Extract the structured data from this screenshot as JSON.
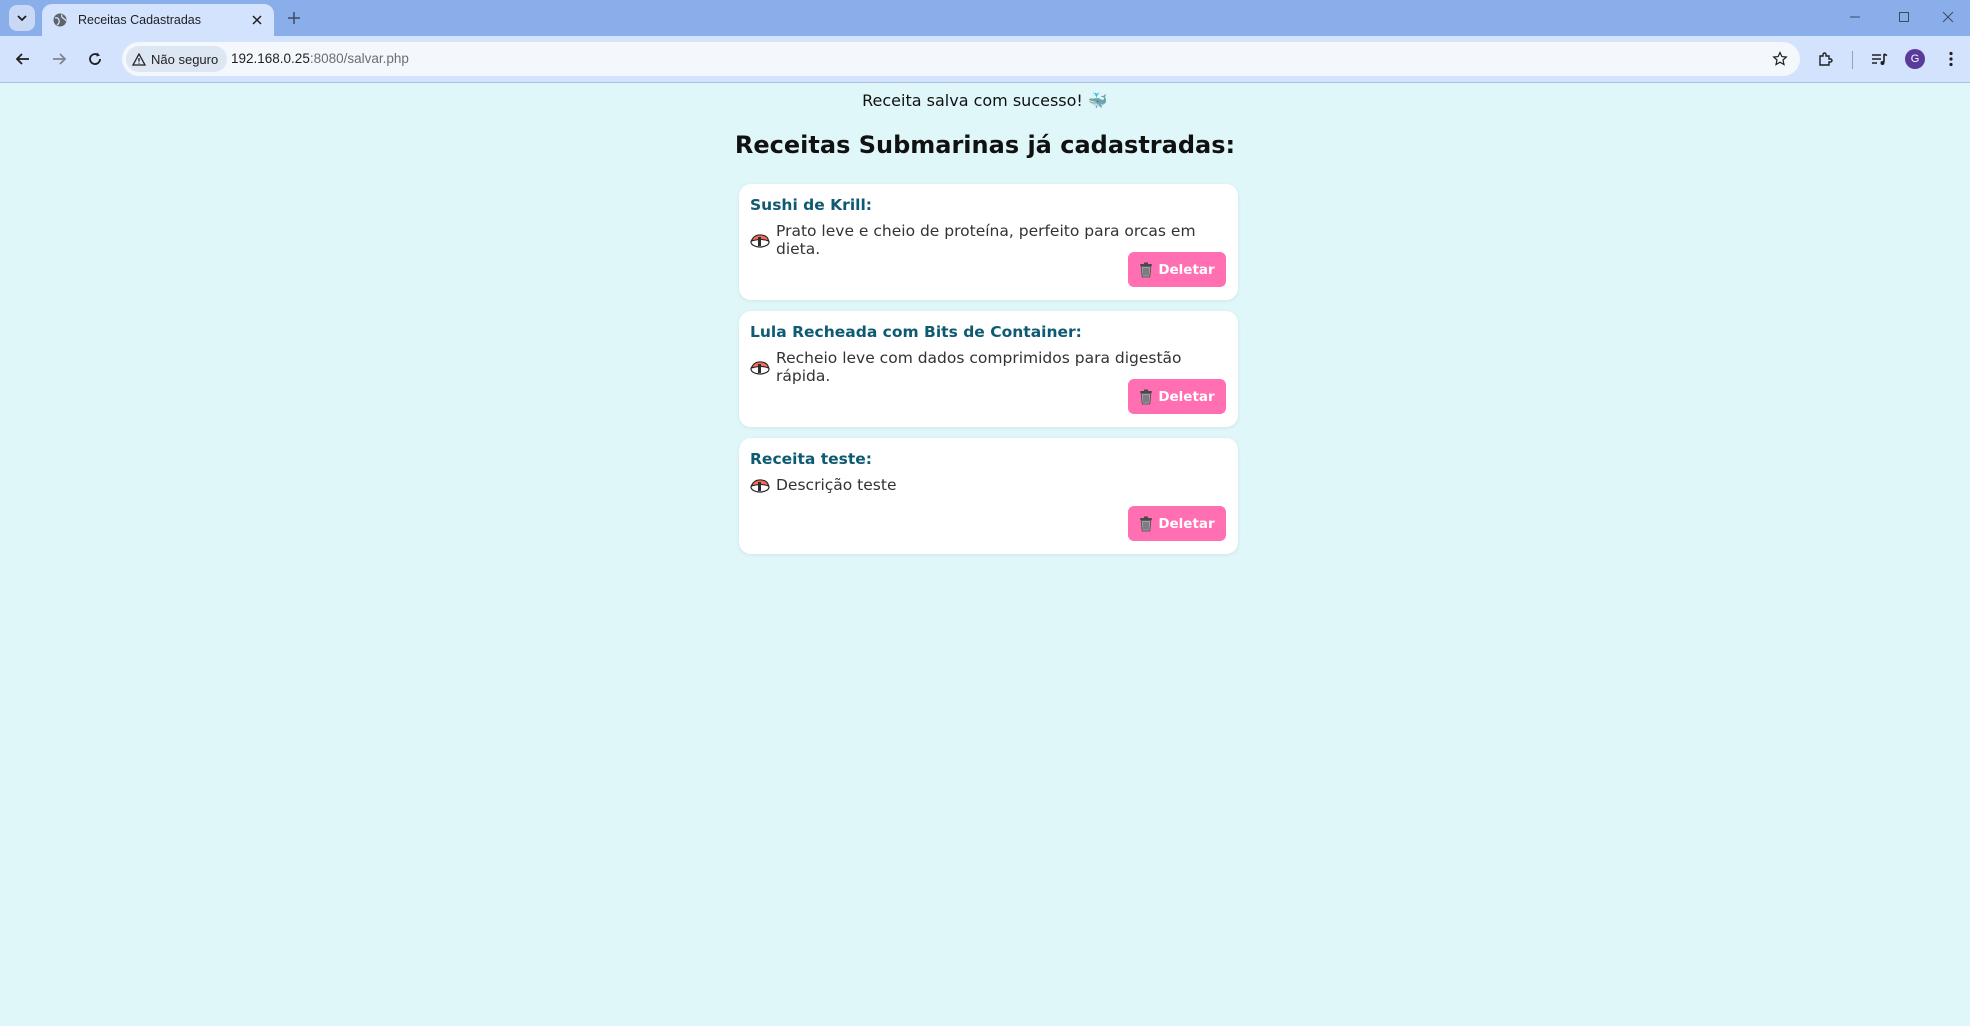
{
  "browser": {
    "tab_title": "Receitas Cadastradas",
    "security_label": "Não seguro",
    "url_host": "192.168.0.25",
    "url_rest": ":8080/salvar.php",
    "profile_initial": "G"
  },
  "page": {
    "success_message": "Receita salva com sucesso! 🐳",
    "title": "Receitas Submarinas já cadastradas:",
    "delete_label": "Deletar",
    "recipes": [
      {
        "name": "Sushi de Krill:",
        "description": "Prato leve e cheio de proteína, perfeito para orcas em dieta."
      },
      {
        "name": "Lula Recheada com Bits de Container:",
        "description": "Recheio leve com dados comprimidos para digestão rápida."
      },
      {
        "name": "Receita teste:",
        "description": "Descrição teste"
      }
    ]
  },
  "colors": {
    "page_bg": "#e0f7f9",
    "title_color": "#0e5a73",
    "delete_button": "#ff6fb2"
  }
}
